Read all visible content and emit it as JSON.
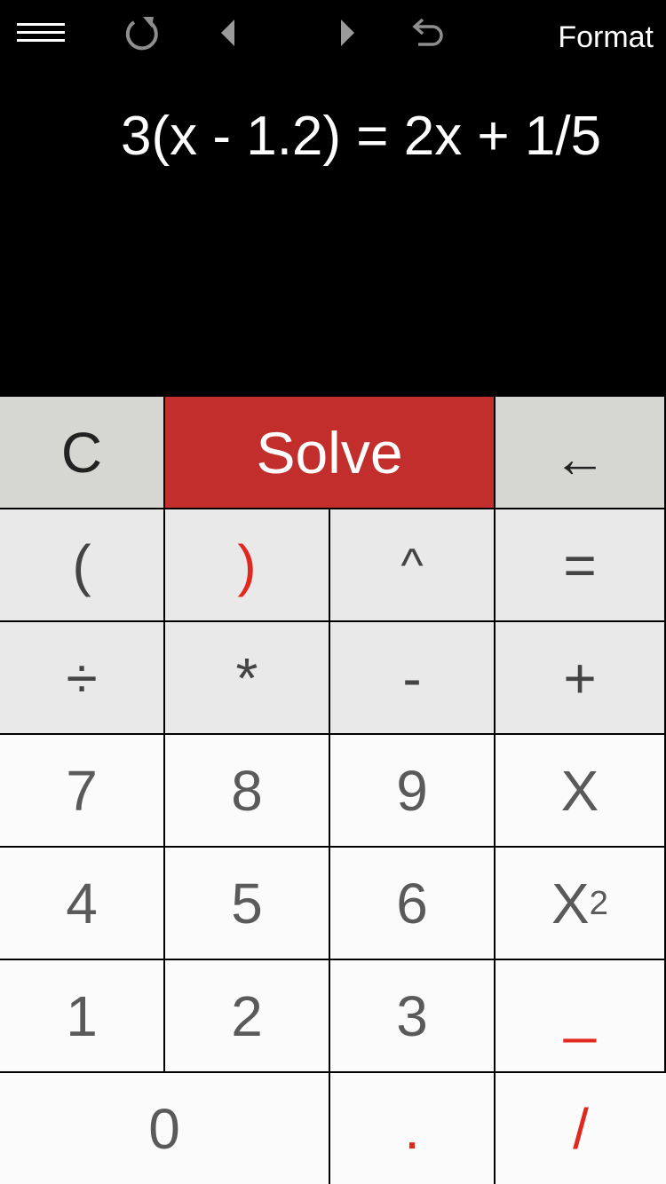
{
  "toolbar": {
    "menu_icon": "hamburger-menu-icon",
    "refresh_icon": "refresh-icon",
    "prev_icon": "triangle-left-icon",
    "next_icon": "triangle-right-icon",
    "undo_icon": "undo-icon",
    "format_label": "Format"
  },
  "display": {
    "expression": "3(x - 1.2) = 2x + 1/5"
  },
  "keys": {
    "clear": "C",
    "solve": "Solve",
    "backspace": "←",
    "open_paren": "(",
    "close_paren": ")",
    "caret": "^",
    "equals": "=",
    "divide": "÷",
    "multiply": "*",
    "minus": "-",
    "plus": "+",
    "seven": "7",
    "eight": "8",
    "nine": "9",
    "x": "X",
    "four": "4",
    "five": "5",
    "six": "6",
    "x_squared_base": "X",
    "x_squared_exp": "2",
    "one": "1",
    "two": "2",
    "three": "3",
    "underscore": "_",
    "zero": "0",
    "dot": ".",
    "slash": "/"
  },
  "colors": {
    "solve_bg": "#c22e2b",
    "accent_red": "#e0281e",
    "top_row_bg": "#d6d6d2",
    "operator_bg": "#e9e9e9",
    "digit_bg": "#fbfbfb"
  }
}
